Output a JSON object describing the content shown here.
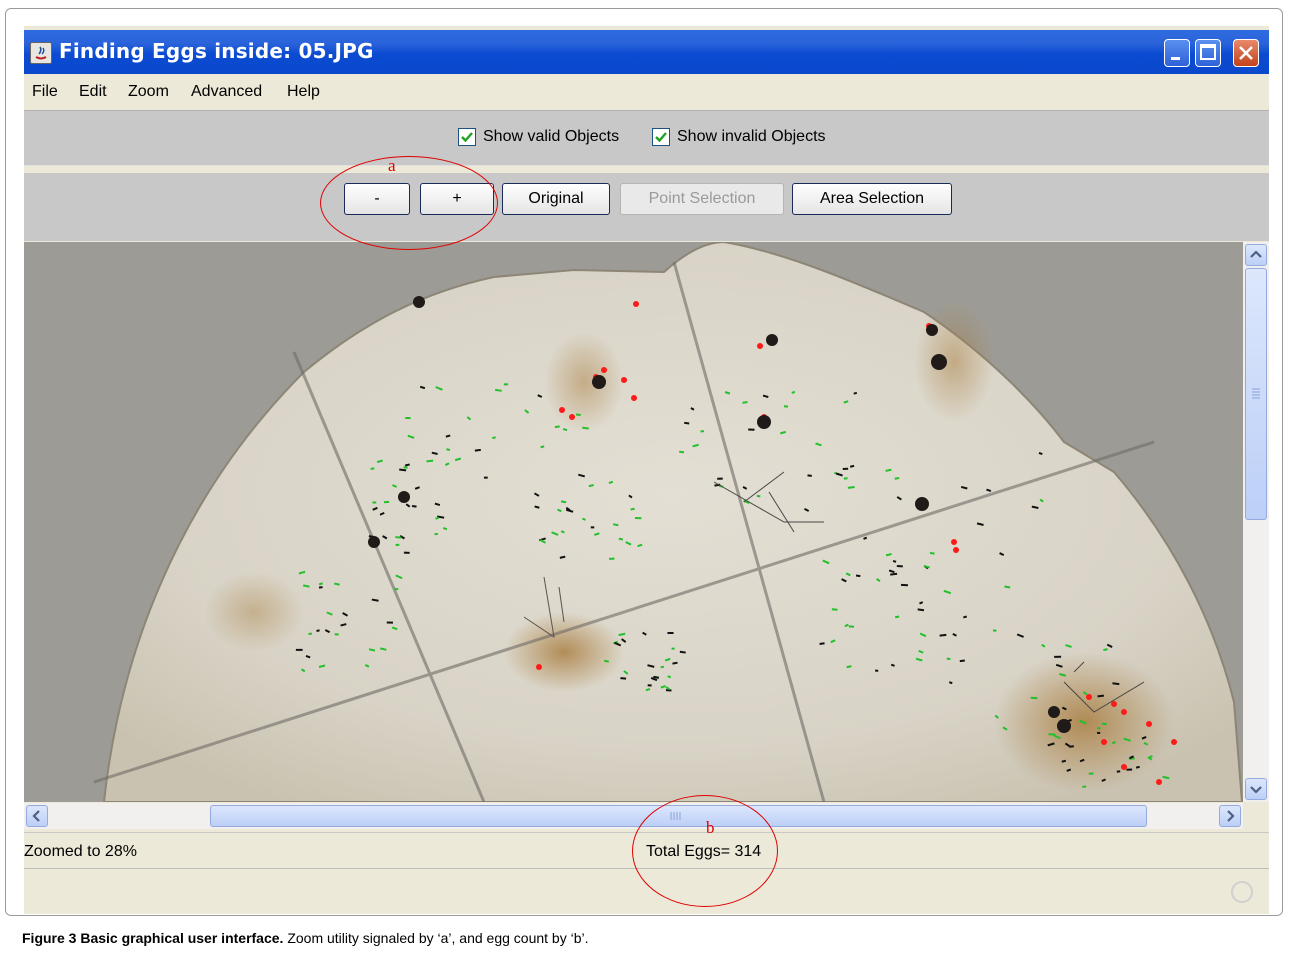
{
  "window": {
    "title": "Finding Eggs inside: 05.JPG"
  },
  "menu": {
    "items": [
      "File",
      "Edit",
      "Zoom",
      "Advanced",
      "Help"
    ]
  },
  "filters": {
    "show_valid": "Show valid Objects",
    "show_invalid": "Show invalid Objects",
    "show_valid_checked": true,
    "show_invalid_checked": true
  },
  "toolbar": {
    "zoom_out": "-",
    "zoom_in": "+",
    "original": "Original",
    "point_selection": "Point Selection",
    "area_selection": "Area Selection"
  },
  "status": {
    "zoom": "Zoomed to 28%",
    "total": "Total Eggs= 314"
  },
  "annotations": {
    "a": "a",
    "b": "b"
  },
  "caption": {
    "label": "Figure 3 Basic graphical user interface.",
    "text": " Zoom utility signaled by ‘a’, and egg count by ‘b’."
  },
  "colors": {
    "valid_marker": "#22c02a",
    "invalid_marker": "#ff1a1a",
    "annotation": "#e00000",
    "titlebar": "#0a48cc"
  }
}
